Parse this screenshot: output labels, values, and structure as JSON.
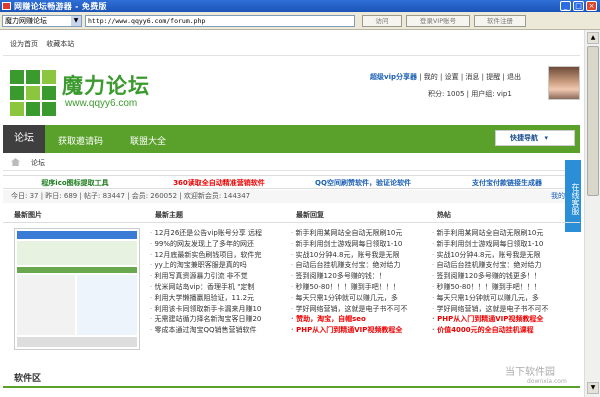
{
  "window": {
    "title": "网赚论坛畅游器 - 免费版"
  },
  "toolbar": {
    "site_select": "魔力网赚论坛",
    "url": "http://www.qqyy6.com/forum.php",
    "visit_label": "访问",
    "login_vip_label": "登录VIP账号",
    "register_label": "软件注册"
  },
  "links": [
    "设为首页",
    "收藏本站"
  ],
  "logo": {
    "title": "魔力论坛",
    "url": "www.qqyy6.com"
  },
  "user": {
    "name": "超级vip分享器",
    "menu": [
      "我的",
      "设置",
      "消息",
      "提醒",
      "退出"
    ],
    "points": "积分: 1005",
    "group": "用户组: vip1"
  },
  "nav": {
    "items": [
      "论坛",
      "获取邀请码",
      "联盟大全"
    ],
    "quick": "快捷导航"
  },
  "breadcrumb": "论坛",
  "ads": [
    "程序ico图标提取工具",
    "360读取全自动精准营销软件",
    "QQ空间刷赞软件，验证论软件",
    "支付宝付款链接生成器"
  ],
  "stats": {
    "text": "今日: 37 | 昨日: 689 | 帖子: 83447 | 会员: 260052 | 欢迎新会员: 144347",
    "right": "我的帖"
  },
  "side_tab": "在线客服",
  "panels": {
    "image": "最新图片",
    "topics": "最新主题",
    "replies": "最新回复",
    "hot": "热帖"
  },
  "topics": [
    "12月26还是公告vip账号分享 远程",
    "99%的网友发现上了多年的网还",
    "12月底最新实色刷钱项目，软件完",
    "yy上的淘宝兼职客服是真的吗",
    "利用写真资源暴力引流 非不觉",
    "忧米网站岛vip：香理手机 \"定制",
    "利用大学懒播赢阻验证，11.2元",
    "利用该卡同领取新手卡漏来月赚10",
    "无需建站循力择名新淘宝客日赚20",
    "零成本通过淘宝QQ销售营销软件"
  ],
  "replies": [
    "新手利用某网站全自动无限刷10元",
    "新手利用剑士游戏网每日领取1-10",
    "实战10分钟4.8元，账号我是无限",
    "自动后台挂机赚支付宝：绝对给力",
    "签到阅赚120多号赚的钱：！",
    "秒赚50-80！！！赚到手吧！！！",
    "每天只需1分钟就可以赚几元，多",
    "学好网络营销，这就是电子书不可不",
    "赞助，淘宝，自帽seo",
    "PHP从入门到精通VIP视频教程全"
  ],
  "hot": [
    "新手利用某网站全自动无限刷10元",
    "新手利用剑士游戏网每日领取1-10",
    "实战10分钟4.8元，账号我是无限",
    "自动后台挂机赚支付宝：绝对给力",
    "签到阅赚120多号赚的钱更多！！",
    "秒赚50-80！！！赚到手吧！！！",
    "每天只需1分钟就可以赚几元，多",
    "学好网络营销，这就是电子书不可不",
    "PHP从入门到精通VIP视频教程全",
    "价值4000元的全自动挂机课程"
  ],
  "section": "软件区",
  "watermark": {
    "main": "当下软件园",
    "sub": "downxia.com"
  },
  "colors": {
    "accent": "#5aa12b",
    "nav_dark": "#3f3f3f",
    "link_red": "#e00000"
  }
}
